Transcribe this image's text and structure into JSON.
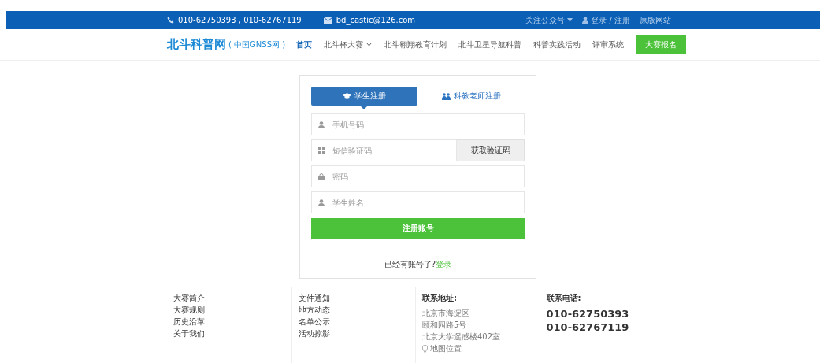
{
  "top_bar": {
    "phone": "010-62750393 , 010-62767119",
    "email": "bd_castic@126.com",
    "follow": "关注公众号",
    "login": "登录 / 注册",
    "site": "原版网站"
  },
  "nav": {
    "logo": "北斗科普网",
    "logo_sub": "( 中国GNSS网 )",
    "items": [
      {
        "label": "首页",
        "selected": true,
        "dropdown": false
      },
      {
        "label": "北斗杯大赛",
        "selected": false,
        "dropdown": true
      },
      {
        "label": "北斗翱翔教育计划",
        "selected": false,
        "dropdown": false
      },
      {
        "label": "北斗卫星导航科普",
        "selected": false,
        "dropdown": false
      },
      {
        "label": "科普实践活动",
        "selected": false,
        "dropdown": false
      },
      {
        "label": "评审系统",
        "selected": false,
        "dropdown": false
      }
    ],
    "cta": "大赛报名"
  },
  "tabs": [
    {
      "label": "学生注册",
      "selected": true
    },
    {
      "label": "科教老师注册",
      "selected": false
    }
  ],
  "fields": [
    {
      "placeholder": "手机号码"
    },
    {
      "placeholder": "短信验证码",
      "button": "获取验证码"
    },
    {
      "placeholder": "密码"
    },
    {
      "placeholder": "学生姓名"
    }
  ],
  "submit": "注册账号",
  "login_prompt": {
    "text": "已经有账号了?",
    "link": "登录"
  },
  "footer": {
    "col1": [
      "大赛简介",
      "大赛规则",
      "历史沿革",
      "关于我们"
    ],
    "col2": [
      "文件通知",
      "地方动态",
      "名单公示",
      "活动掠影"
    ],
    "address_title": "联系地址:",
    "address": [
      "北京市海淀区",
      "颐和园路5号",
      "北京大学遥感楼402室"
    ],
    "map": "地图位置",
    "phone_title": "联系电话:",
    "phones": [
      "010-62750393",
      "010-62767119"
    ]
  }
}
